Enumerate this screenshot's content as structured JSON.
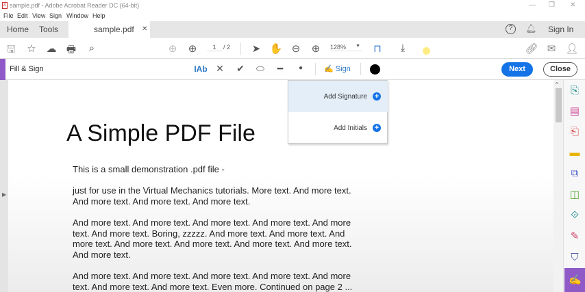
{
  "window": {
    "title": "sample.pdf - Adobe Acrobat Reader DC (64-bit)"
  },
  "menu": [
    "File",
    "Edit",
    "View",
    "Sign",
    "Window",
    "Help"
  ],
  "tabs": {
    "home": "Home",
    "tools": "Tools",
    "document": "sample.pdf",
    "sign_in": "Sign In"
  },
  "toolbar": {
    "page_current": "1",
    "page_total": "/ 2",
    "zoom": "128%"
  },
  "fill_sign": {
    "title": "Fill & Sign",
    "sign_label": "Sign",
    "next_label": "Next",
    "close_label": "Close",
    "color": "#000000"
  },
  "signature_menu": {
    "add_signature": "Add Signature",
    "add_initials": "Add Initials"
  },
  "document": {
    "heading": "A Simple PDF File",
    "paragraphs": [
      "This is a small demonstration .pdf file -",
      "just for use in the Virtual Mechanics tutorials. More text. And more text. And more text. And more text. And more text.",
      "And more text. And more text. And more text. And more text. And more text. And more text. Boring, zzzzz. And more text. And more text. And more text. And more text. And more text. And more text. And more text. And more text.",
      "And more text. And more text. And more text. And more text. And more text. And more text. And more text. Even more. Continued on page 2 ..."
    ]
  },
  "colors": {
    "accent": "#1473e6",
    "fill_sign": "#8f5ac8"
  }
}
